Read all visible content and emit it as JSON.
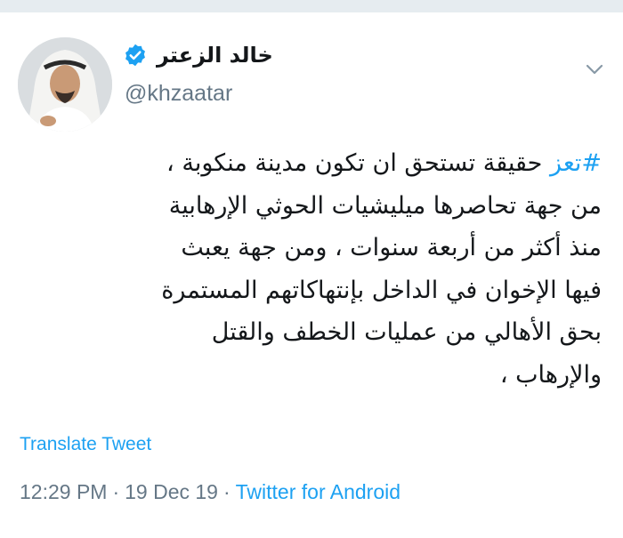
{
  "colors": {
    "accent": "#1da1f2",
    "text_primary": "#14171a",
    "text_secondary": "#657786",
    "separator": "#e6ecf0"
  },
  "author": {
    "display_name": "خالد الزعتر",
    "handle": "@khzaatar",
    "verified": true,
    "avatar_icon": "avatar-photo"
  },
  "tweet": {
    "hashtag": "#تعز",
    "first_line_rest": " حقيقة تستحق ان تكون مدينة منكوبة ،",
    "lines": [
      "من جهة تحاصرها ميليشيات الحوثي الإرهابية",
      "منذ أكثر من أربعة سنوات ، ومن جهة يعبث",
      "فيها الإخوان في الداخل بإنتهاكاتهم المستمرة",
      "بحق الأهالي من عمليات الخطف والقتل",
      "والإرهاب ،"
    ]
  },
  "actions": {
    "translate_label": "Translate Tweet",
    "menu_icon": "chevron-down-icon"
  },
  "meta": {
    "time": "12:29 PM",
    "separator": "·",
    "date": "19 Dec 19",
    "source": "Twitter for Android"
  }
}
